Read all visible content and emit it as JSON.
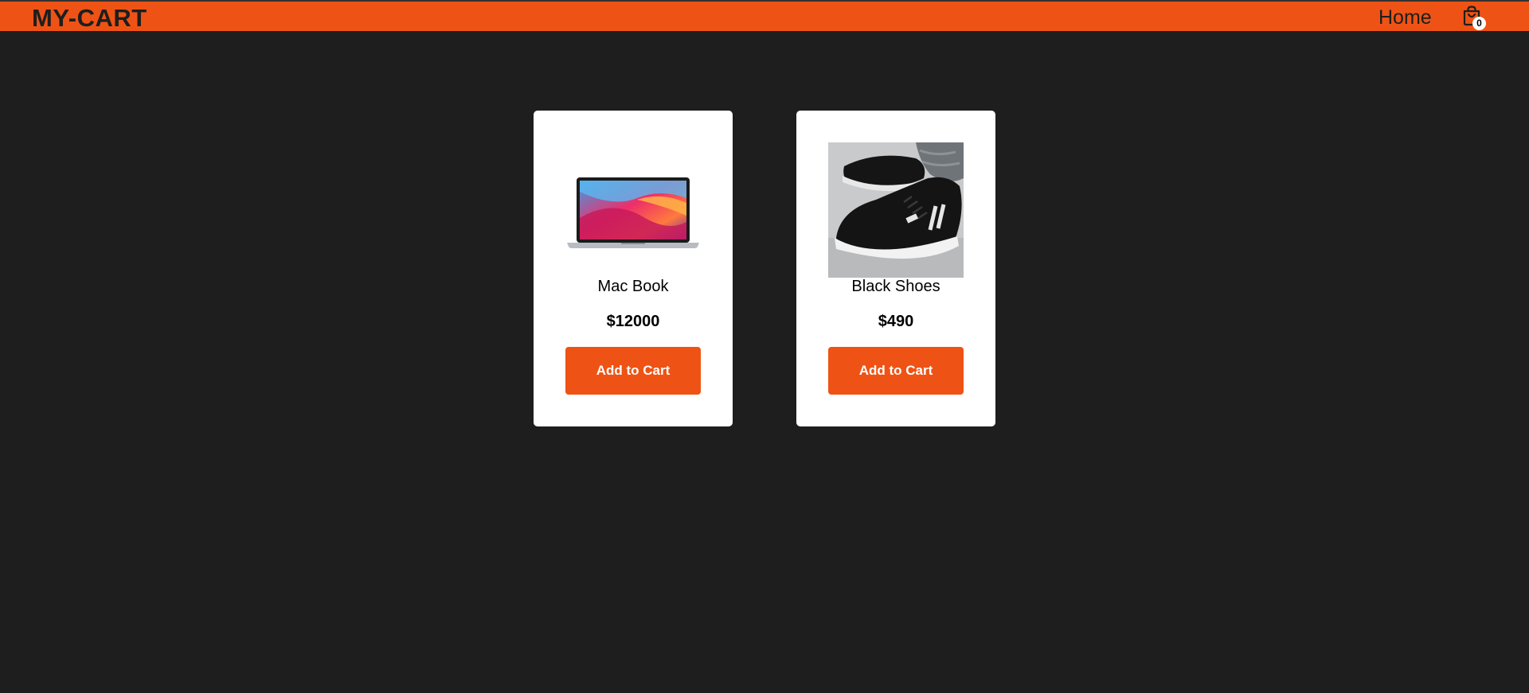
{
  "navbar": {
    "brand": "MY-CART",
    "home_label": "Home",
    "cart_count": "0",
    "cart_icon": "shopping-bag-icon",
    "accent_color": "#ee5315",
    "background_color": "#1e1e1e"
  },
  "products": [
    {
      "name": "Mac Book",
      "price": "$12000",
      "button_label": "Add to Cart",
      "image": "laptop-image"
    },
    {
      "name": "Black Shoes",
      "price": "$490",
      "button_label": "Add to Cart",
      "image": "shoes-image"
    }
  ]
}
